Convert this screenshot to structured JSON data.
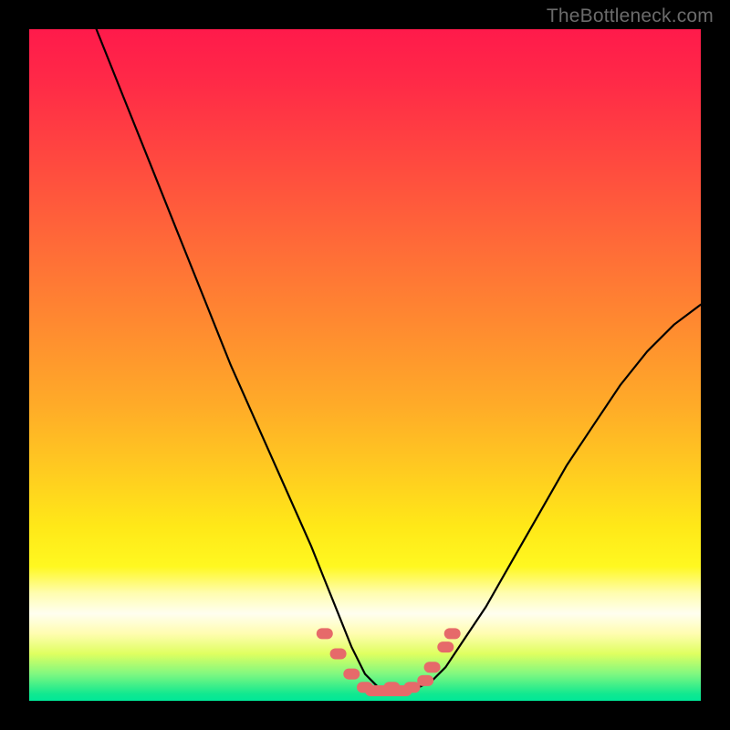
{
  "watermark": "TheBottleneck.com",
  "chart_data": {
    "type": "line",
    "title": "",
    "xlabel": "",
    "ylabel": "",
    "xlim": [
      0,
      100
    ],
    "ylim": [
      0,
      100
    ],
    "grid": false,
    "series": [
      {
        "name": "curve",
        "color": "#000000",
        "x": [
          10,
          14,
          18,
          22,
          26,
          30,
          34,
          38,
          42,
          44,
          46,
          48,
          50,
          52,
          54,
          56,
          58,
          60,
          62,
          64,
          68,
          72,
          76,
          80,
          84,
          88,
          92,
          96,
          100
        ],
        "y": [
          100,
          90,
          80,
          70,
          60,
          50,
          41,
          32,
          23,
          18,
          13,
          8,
          4,
          2,
          1,
          1,
          2,
          3,
          5,
          8,
          14,
          21,
          28,
          35,
          41,
          47,
          52,
          56,
          59
        ]
      },
      {
        "name": "markers",
        "color": "#e66a6a",
        "type": "scatter",
        "x": [
          44,
          46,
          48,
          50,
          54,
          57,
          59,
          60,
          62,
          63
        ],
        "y": [
          10,
          7,
          4,
          2,
          2,
          2,
          3,
          5,
          8,
          10
        ]
      }
    ],
    "gradient_stops": [
      {
        "pos": 0,
        "color": "#ff1a4b"
      },
      {
        "pos": 50,
        "color": "#ffab28"
      },
      {
        "pos": 80,
        "color": "#fff820"
      },
      {
        "pos": 87,
        "color": "#fffef0"
      },
      {
        "pos": 96,
        "color": "#80f880"
      },
      {
        "pos": 100,
        "color": "#00e898"
      }
    ]
  }
}
